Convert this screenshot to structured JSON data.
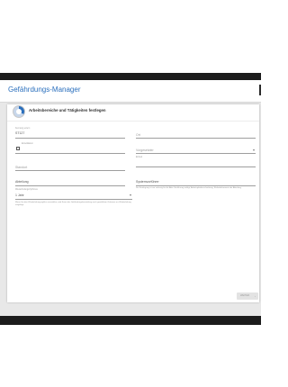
{
  "topbar": {
    "text": ""
  },
  "app": {
    "title": "Gefährdungs-Manager"
  },
  "card": {
    "title": "Arbeitsbereiche und Tätigkeiten festlegen"
  },
  "form": {
    "kennung": {
      "label": "Kennung extern",
      "value": "ST127"
    },
    "ort": {
      "label": "",
      "value": "Ort"
    },
    "erstelldatum": {
      "label": "Erstelldatum",
      "value": ""
    },
    "vorgesetzter": {
      "label": "",
      "value": "Vorgesetzter"
    },
    "standort": {
      "label": "",
      "value": "Standort"
    },
    "einheit": {
      "label": "Einheit",
      "value": ""
    },
    "abteilung": {
      "label": "",
      "value": "Abteilung"
    },
    "systemvorfuehrer": {
      "label": "",
      "value": "Systemvorführer",
      "hint": "Die Festlegung ist nur zulässig für die Akte. Hinführung erfolgt, Arbeitsplatzbeschreibung, Risikodokumente der Abteilung."
    },
    "wiederholung": {
      "label": "Wiederholungsrhythmus",
      "value": "1 Jahr"
    },
    "note": "Wenn Sie den Wiederholungszyklus auswählen, wird Ihnen der Gefährdungsbeurteilung nach gewähltem Zeitraum zur Wiederholung vorgelegt."
  },
  "buttons": {
    "next": "WEITER",
    "next_arrow": "›"
  },
  "colors": {
    "accent": "#2a6fbd",
    "line": "#9e9e9e"
  },
  "icons": {
    "step": "progress-ring-icon",
    "calendar": "calendar-icon",
    "dropdown": "chevron-down-icon",
    "next": "chevron-right-icon"
  }
}
